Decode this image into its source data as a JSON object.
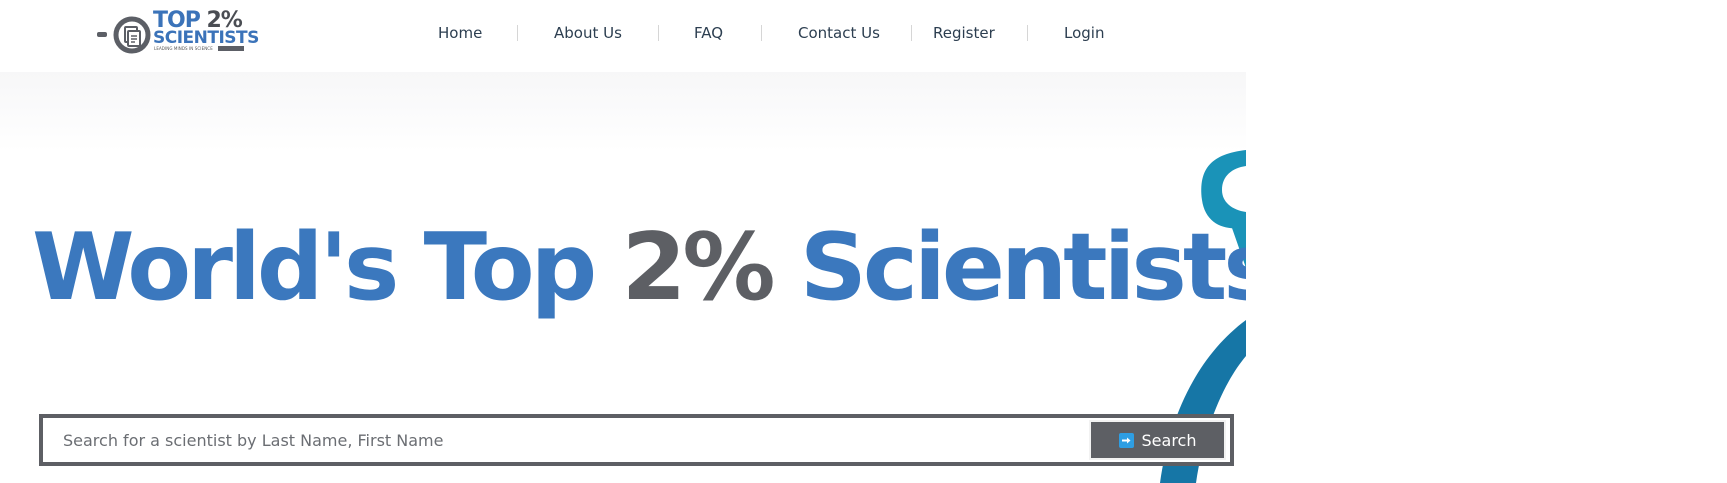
{
  "logo": {
    "line1_main": "TOP ",
    "line1_pct": "2%",
    "line2": "SCIENTISTS",
    "tagline": "LEADING MINDS IN SCIENCE"
  },
  "nav": {
    "items": [
      {
        "label": "Home"
      },
      {
        "label": "About Us"
      },
      {
        "label": "FAQ"
      },
      {
        "label": "Contact Us"
      },
      {
        "label": "Register"
      },
      {
        "label": "Login"
      }
    ]
  },
  "hero": {
    "title_part1": "World's Top ",
    "title_accent": "2%",
    "title_part2": " Scientists"
  },
  "search": {
    "placeholder": "Search for a scientist by Last Name, First Name",
    "value": "",
    "button_label": "Search",
    "button_icon": "arrow-right-icon"
  },
  "colors": {
    "brand_blue": "#3b78be",
    "brand_gray": "#5d5f64",
    "deco_teal": "#1a93b8",
    "icon_blue": "#2e9ee3"
  }
}
